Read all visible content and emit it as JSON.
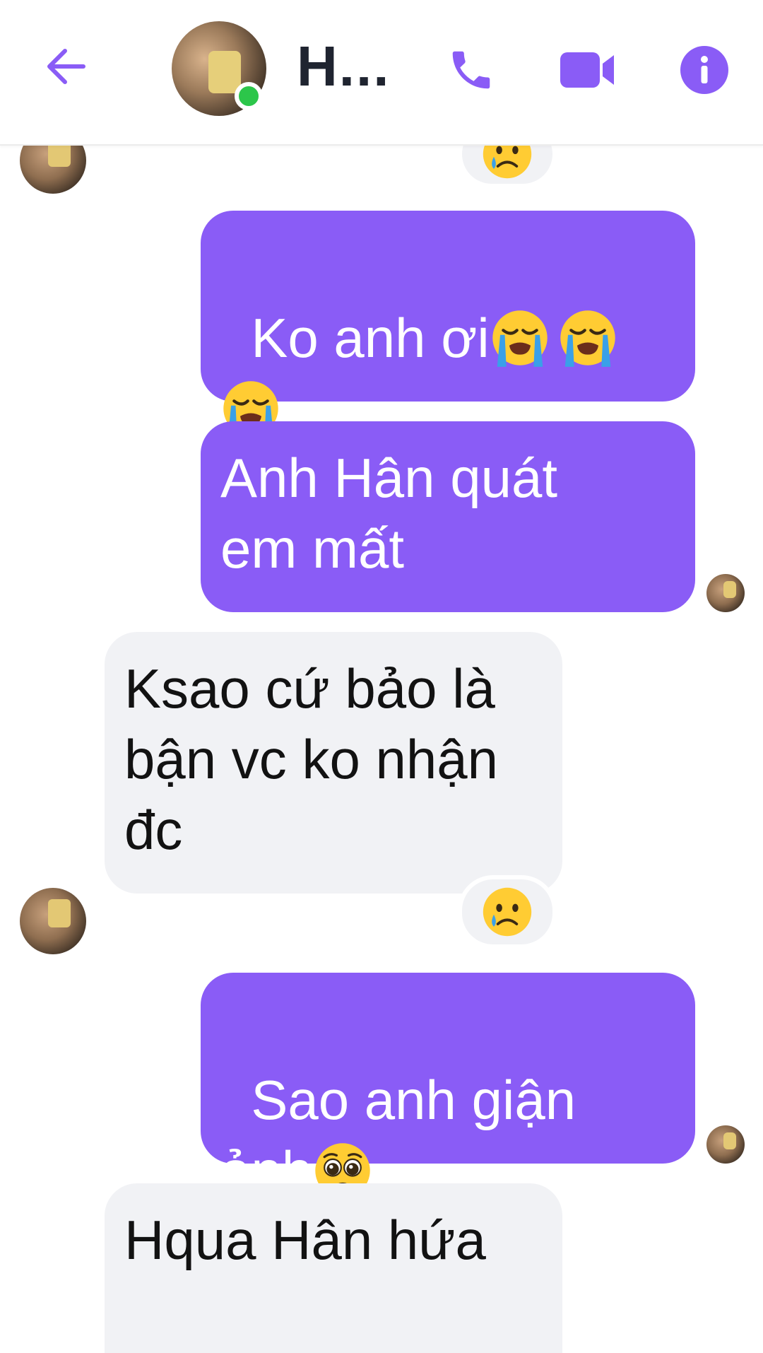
{
  "header": {
    "contact_name": "H...",
    "online": true,
    "accent_color": "#8a5cf6",
    "icons": [
      "back-arrow-icon",
      "phone-icon",
      "video-camera-icon",
      "info-icon"
    ]
  },
  "messages": [
    {
      "direction": "incoming",
      "reaction": "crying-face",
      "partial": true
    },
    {
      "direction": "outgoing",
      "text_lines": [
        "Ko anh ơi",
        ""
      ],
      "emojis": [
        "loudly-crying-face",
        "loudly-crying-face",
        "loudly-crying-face"
      ]
    },
    {
      "direction": "outgoing",
      "text": "Anh Hân quát\nem mất"
    },
    {
      "direction": "incoming",
      "text": "Ksao cứ bảo là\nbận vc ko nhận\nđc",
      "reaction": "crying-face"
    },
    {
      "direction": "outgoing",
      "text_lines": [
        "Sao anh giận",
        "ảnh"
      ],
      "emojis": [
        "pleading-face"
      ]
    },
    {
      "direction": "incoming",
      "text": "Hqua Hân hứa",
      "partial": true
    }
  ],
  "colors": {
    "outgoing_bubble": "#8a5cf6",
    "incoming_bubble": "#f1f2f5",
    "online_dot": "#2cc64a"
  }
}
